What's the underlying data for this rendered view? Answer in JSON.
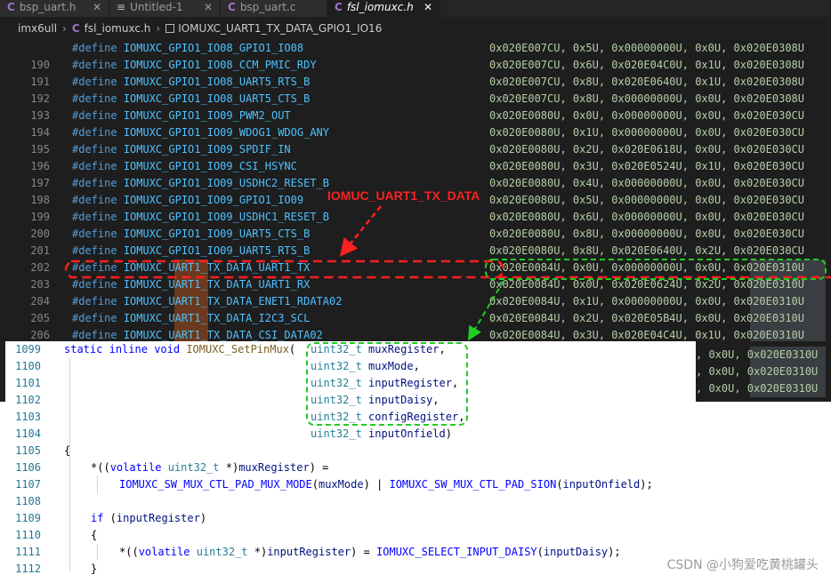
{
  "tabs": [
    {
      "icon": "C",
      "label": "bsp_uart.h",
      "active": false
    },
    {
      "icon": "",
      "label": "Untitled-1",
      "active": false
    },
    {
      "icon": "C",
      "label": "bsp_uart.c",
      "active": false
    },
    {
      "icon": "C",
      "label": "fsl_iomuxc.h",
      "active": true
    }
  ],
  "breadcrumb": {
    "folder": "imx6ull",
    "file": "fsl_iomuxc.h",
    "symbol": "IOMUXC_UART1_TX_DATA_GPIO1_IO16"
  },
  "editor_top": {
    "lines": [
      {
        "num": "",
        "name": "IOMUXC_GPIO1_IO08_GPIO1_IO08",
        "vals": "0x020E007CU, 0x5U, 0x00000000U, 0x0U, 0x020E0308U"
      },
      {
        "num": "190",
        "name": "IOMUXC_GPIO1_IO08_CCM_PMIC_RDY",
        "vals": "0x020E007CU, 0x6U, 0x020E04C0U, 0x1U, 0x020E0308U"
      },
      {
        "num": "191",
        "name": "IOMUXC_GPIO1_IO08_UART5_RTS_B",
        "vals": "0x020E007CU, 0x8U, 0x020E0640U, 0x1U, 0x020E0308U"
      },
      {
        "num": "192",
        "name": "IOMUXC_GPIO1_IO08_UART5_CTS_B",
        "vals": "0x020E007CU, 0x8U, 0x00000000U, 0x0U, 0x020E0308U"
      },
      {
        "num": "193",
        "name": "IOMUXC_GPIO1_IO09_PWM2_OUT",
        "vals": "0x020E0080U, 0x0U, 0x00000000U, 0x0U, 0x020E030CU"
      },
      {
        "num": "194",
        "name": "IOMUXC_GPIO1_IO09_WDOG1_WDOG_ANY",
        "vals": "0x020E0080U, 0x1U, 0x00000000U, 0x0U, 0x020E030CU"
      },
      {
        "num": "195",
        "name": "IOMUXC_GPIO1_IO09_SPDIF_IN",
        "vals": "0x020E0080U, 0x2U, 0x020E0618U, 0x0U, 0x020E030CU"
      },
      {
        "num": "196",
        "name": "IOMUXC_GPIO1_IO09_CSI_HSYNC",
        "vals": "0x020E0080U, 0x3U, 0x020E0524U, 0x1U, 0x020E030CU"
      },
      {
        "num": "197",
        "name": "IOMUXC_GPIO1_IO09_USDHC2_RESET_B",
        "vals": "0x020E0080U, 0x4U, 0x00000000U, 0x0U, 0x020E030CU"
      },
      {
        "num": "198",
        "name": "IOMUXC_GPIO1_IO09_GPIO1_IO09",
        "vals": "0x020E0080U, 0x5U, 0x00000000U, 0x0U, 0x020E030CU"
      },
      {
        "num": "199",
        "name": "IOMUXC_GPIO1_IO09_USDHC1_RESET_B",
        "vals": "0x020E0080U, 0x6U, 0x00000000U, 0x0U, 0x020E030CU"
      },
      {
        "num": "200",
        "name": "IOMUXC_GPIO1_IO09_UART5_CTS_B",
        "vals": "0x020E0080U, 0x8U, 0x00000000U, 0x0U, 0x020E030CU"
      },
      {
        "num": "201",
        "name": "IOMUXC_GPIO1_IO09_UART5_RTS_B",
        "vals": "0x020E0080U, 0x8U, 0x020E0640U, 0x2U, 0x020E030CU"
      },
      {
        "num": "202",
        "name": "IOMUXC_UART1_TX_DATA_UART1_TX",
        "vals": "0x020E0084U, 0x0U, 0x00000000U, 0x0U, 0x020E0310U"
      },
      {
        "num": "203",
        "name": "IOMUXC_UART1_TX_DATA_UART1_RX",
        "vals": "0x020E0084U, 0x0U, 0x020E0624U, 0x2U, 0x020E0310U"
      },
      {
        "num": "204",
        "name": "IOMUXC_UART1_TX_DATA_ENET1_RDATA02",
        "vals": "0x020E0084U, 0x1U, 0x00000000U, 0x0U, 0x020E0310U"
      },
      {
        "num": "205",
        "name": "IOMUXC_UART1_TX_DATA_I2C3_SCL",
        "vals": "0x020E0084U, 0x2U, 0x020E05B4U, 0x0U, 0x020E0310U"
      },
      {
        "num": "206",
        "name": "IOMUXC_UART1_TX_DATA_CSI_DATA02",
        "vals": "0x020E0084U, 0x3U, 0x020E04C4U, 0x1U, 0x020E0310U"
      }
    ],
    "define_kw": "#define",
    "extra_vals": [
      ", 0x0U, 0x020E0310U",
      ", 0x0U, 0x020E0310U",
      ", 0x0U, 0x020E0310U"
    ]
  },
  "editor_popup": {
    "lines": [
      {
        "num": "1099"
      },
      {
        "num": "1100"
      },
      {
        "num": "1101"
      },
      {
        "num": "1102"
      },
      {
        "num": "1103"
      },
      {
        "num": "1104"
      },
      {
        "num": "1105"
      },
      {
        "num": "1106"
      },
      {
        "num": "1107"
      },
      {
        "num": "1108"
      },
      {
        "num": "1109"
      },
      {
        "num": "1110"
      },
      {
        "num": "1111"
      },
      {
        "num": "1112"
      }
    ],
    "sig": {
      "static": "static",
      "inline": "inline",
      "void": "void",
      "fn": "IOMUXC_SetPinMux"
    },
    "params": [
      {
        "type": "uint32_t",
        "name": "muxRegister",
        "end": ","
      },
      {
        "type": "uint32_t",
        "name": "muxMode",
        "end": ","
      },
      {
        "type": "uint32_t",
        "name": "inputRegister",
        "end": ","
      },
      {
        "type": "uint32_t",
        "name": "inputDaisy",
        "end": ","
      },
      {
        "type": "uint32_t",
        "name": "configRegister",
        "end": ","
      },
      {
        "type": "uint32_t",
        "name": "inputOnfield",
        "end": ")"
      }
    ],
    "open_brace": "{",
    "close_brace": "}",
    "l1106": {
      "pre": "*((",
      "kw": "volatile",
      "ty": "uint32_t",
      "mid": " *)",
      "var": "muxRegister",
      "post": ") ="
    },
    "l1107": {
      "m1": "IOMUXC_SW_MUX_CTL_PAD_MUX_MODE",
      "a1": "muxMode",
      "or": ") | ",
      "m2": "IOMUXC_SW_MUX_CTL_PAD_SION",
      "a2": "inputOnfield",
      "end": ");"
    },
    "l1109": {
      "kw": "if",
      "var": "inputRegister"
    },
    "l1111": {
      "pre": "*((",
      "kw": "volatile",
      "ty": "uint32_t",
      "mid": " *)",
      "var": "inputRegister",
      "eq": ") = ",
      "m": "IOMUXC_SELECT_INPUT_DAISY",
      "a": "inputDaisy",
      "end": ");"
    }
  },
  "annotation": {
    "label": "IOMUC_UART1_TX_DATA",
    "color": "#ff2020",
    "green": "#22cc22"
  },
  "watermark": "CSDN @小狗爱吃黄桃罐头"
}
